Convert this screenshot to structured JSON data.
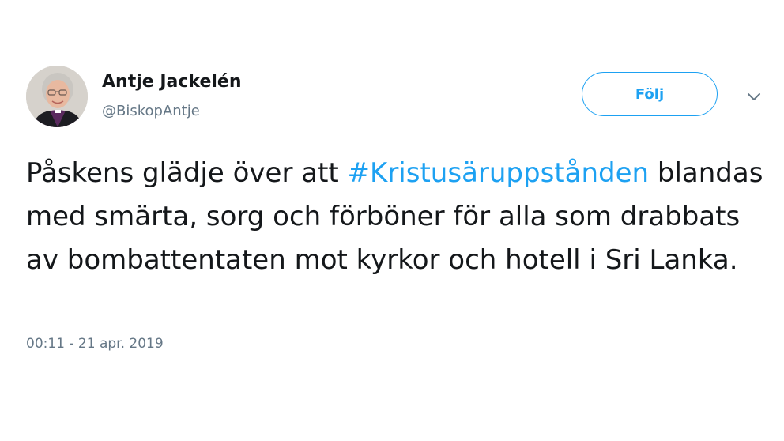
{
  "author": {
    "display_name": "Antje Jackelén",
    "handle": "@BiskopAntje"
  },
  "actions": {
    "follow_label": "Följ",
    "more_icon": "chevron-down-icon"
  },
  "tweet": {
    "text_before": "Påskens glädje över att ",
    "hashtag": "#Kristusäruppstånden",
    "text_after": " blandas med smärta, sorg och förböner för alla som drabbats av bombattentaten mot kyrkor och hotell i Sri Lanka.",
    "timestamp": "00:11 - 21 apr. 2019"
  },
  "colors": {
    "accent": "#1da1f2",
    "text": "#14171a",
    "secondary_text": "#657786"
  }
}
